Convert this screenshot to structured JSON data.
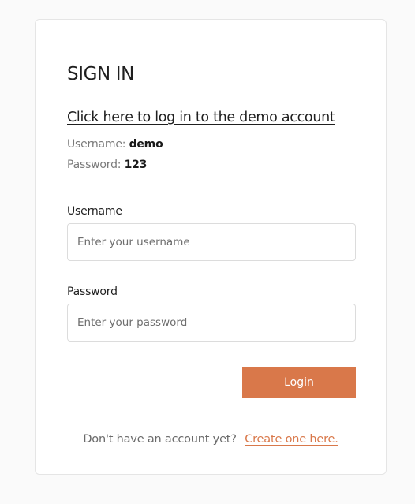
{
  "signin": {
    "title": "SIGN IN",
    "demo_link": "Click here to log in to the demo account",
    "demo_username_label": "Username:",
    "demo_username_value": "demo",
    "demo_password_label": "Password:",
    "demo_password_value": "123"
  },
  "form": {
    "username_label": "Username",
    "username_placeholder": "Enter your username",
    "password_label": "Password",
    "password_placeholder": "Enter your password",
    "login_label": "Login"
  },
  "footer": {
    "prompt": "Don't have an account yet?",
    "create_link": "Create one here."
  },
  "colors": {
    "accent": "#d9784a",
    "background": "#fafafa",
    "card": "#ffffff"
  }
}
